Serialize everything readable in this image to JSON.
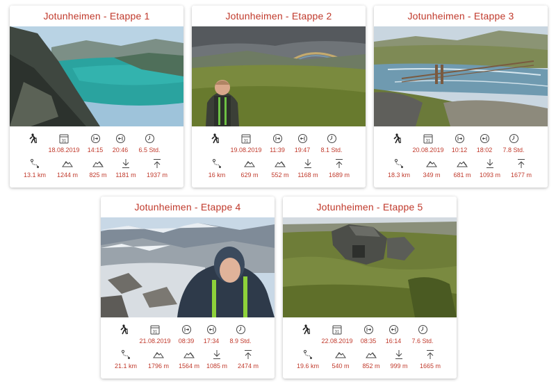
{
  "cards": [
    {
      "title": "Jotunheimen - Etappe 1",
      "date": "18.08.2019",
      "start": "14:15",
      "end": "20:46",
      "duration": "6.5 Std.",
      "distance": "13.1 km",
      "ascent": "1244 m",
      "descent": "825 m",
      "min_alt": "1181 m",
      "max_alt": "1937 m"
    },
    {
      "title": "Jotunheimen - Etappe 2",
      "date": "19.08.2019",
      "start": "11:39",
      "end": "19:47",
      "duration": "8.1 Std.",
      "distance": "16 km",
      "ascent": "629 m",
      "descent": "552 m",
      "min_alt": "1168 m",
      "max_alt": "1689 m"
    },
    {
      "title": "Jotunheimen - Etappe 3",
      "date": "20.08.2019",
      "start": "10:12",
      "end": "18:02",
      "duration": "7.8 Std.",
      "distance": "18.3 km",
      "ascent": "349 m",
      "descent": "681 m",
      "min_alt": "1093 m",
      "max_alt": "1677 m"
    },
    {
      "title": "Jotunheimen - Etappe 4",
      "date": "21.08.2019",
      "start": "08:39",
      "end": "17:34",
      "duration": "8.9 Std.",
      "distance": "21.1 km",
      "ascent": "1796 m",
      "descent": "1564 m",
      "min_alt": "1085 m",
      "max_alt": "2474 m"
    },
    {
      "title": "Jotunheimen - Etappe 5",
      "date": "22.08.2019",
      "start": "08:35",
      "end": "16:14",
      "duration": "7.6 Std.",
      "distance": "19.6 km",
      "ascent": "540 m",
      "descent": "852 m",
      "min_alt": "999 m",
      "max_alt": "1665 m"
    }
  ],
  "icons": {
    "calendar_day": "31"
  },
  "colors": {
    "accent": "#c0392b",
    "icon": "#444444",
    "title": "#c0392b"
  }
}
